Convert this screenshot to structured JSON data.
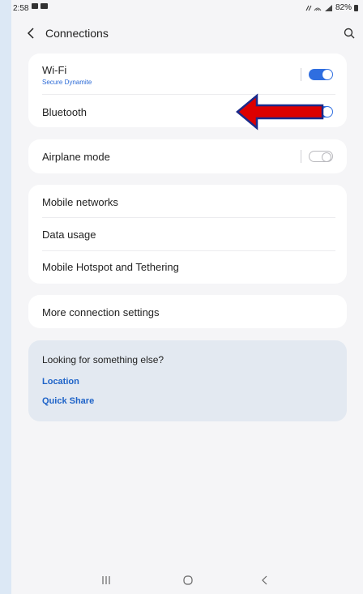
{
  "status_bar": {
    "time": "2:58",
    "battery": "82%"
  },
  "header": {
    "title": "Connections"
  },
  "groups": {
    "wireless": {
      "wifi": {
        "label": "Wi-Fi",
        "network": "Secure Dynamite",
        "toggle": "on"
      },
      "bluetooth": {
        "label": "Bluetooth",
        "toggle": "on"
      }
    },
    "airplane": {
      "label": "Airplane mode",
      "toggle": "off"
    },
    "networks": {
      "items": [
        "Mobile networks",
        "Data usage",
        "Mobile Hotspot and Tethering"
      ]
    },
    "more": {
      "label": "More connection settings"
    },
    "looking": {
      "title": "Looking for something else?",
      "links": [
        "Location",
        "Quick Share"
      ]
    }
  },
  "colors": {
    "accent": "#2f6ee0",
    "link": "#1e63c8",
    "arrow_fill": "#dd0000",
    "arrow_outline": "#1a2a8a"
  },
  "icons": {
    "back": "back-arrow-icon",
    "search": "search-icon",
    "nav_recents": "recents-icon",
    "nav_home": "home-icon",
    "nav_back": "nav-back-icon"
  }
}
